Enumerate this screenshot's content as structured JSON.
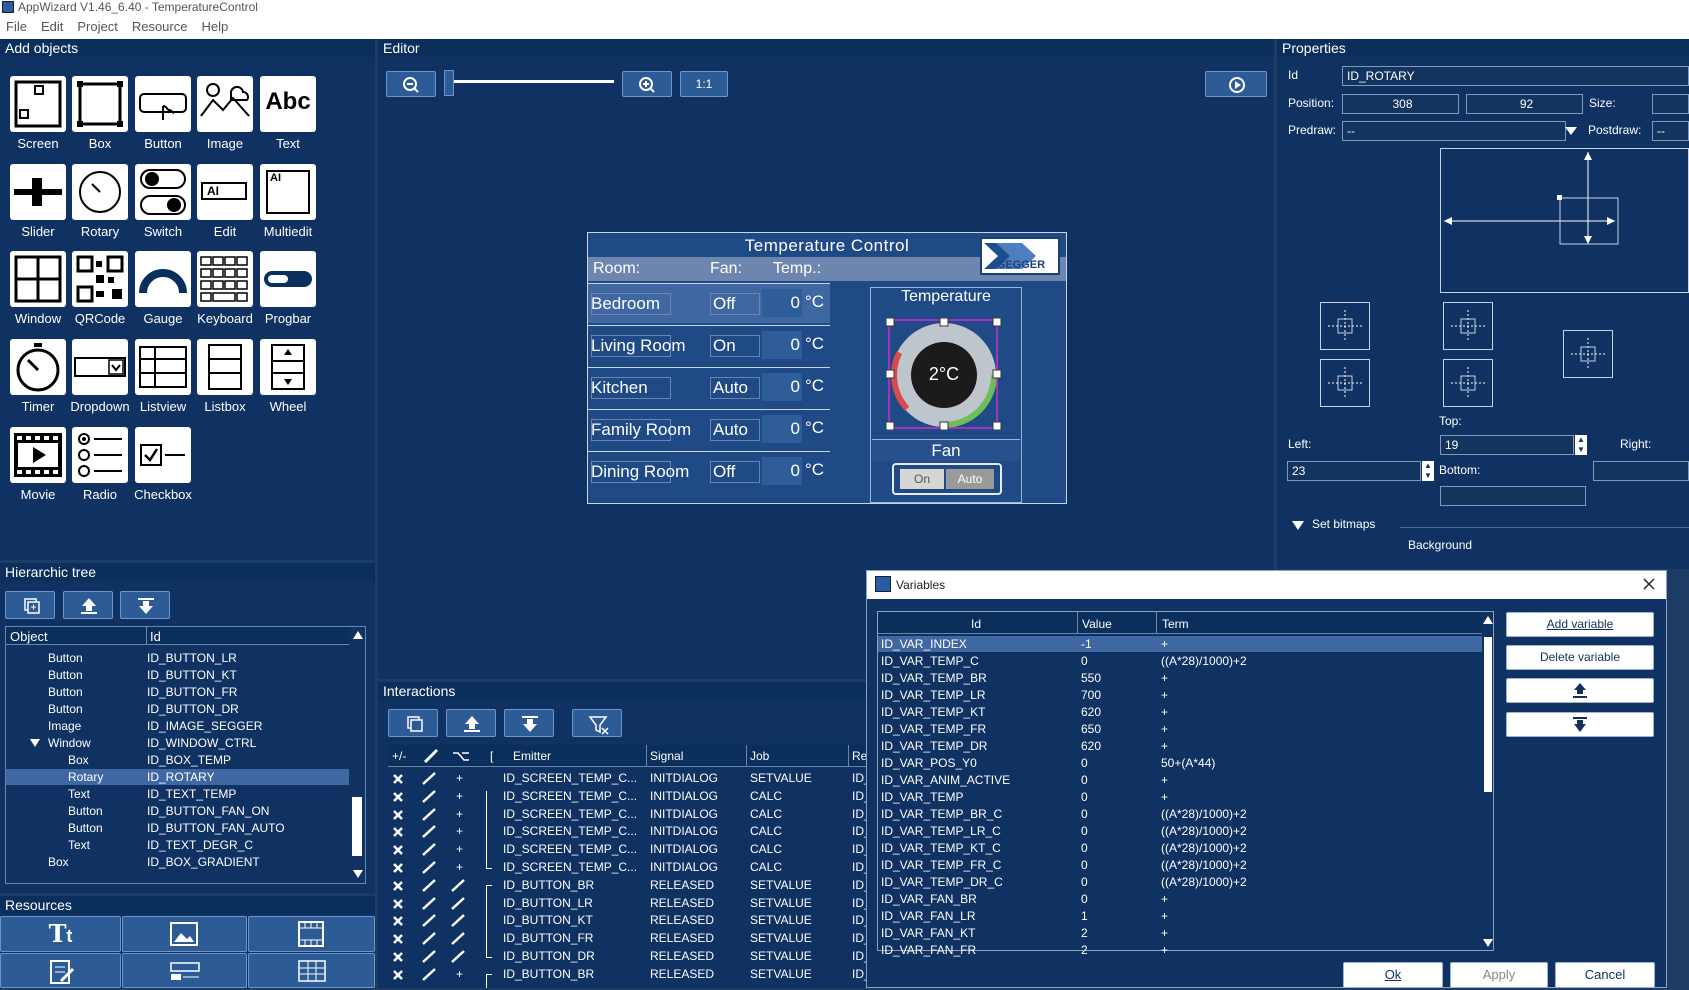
{
  "window": {
    "title": "AppWizard V1.46_6.40 - TemperatureControl"
  },
  "menu": [
    "File",
    "Edit",
    "Project",
    "Resource",
    "Help"
  ],
  "add_objects": {
    "title": "Add objects",
    "items": [
      {
        "label": "Screen",
        "icon": "screen-icon"
      },
      {
        "label": "Box",
        "icon": "box-icon"
      },
      {
        "label": "Button",
        "icon": "button-icon"
      },
      {
        "label": "Image",
        "icon": "image-icon"
      },
      {
        "label": "Text",
        "icon": "text-icon",
        "glyph": "Abc"
      },
      {
        "label": "Slider",
        "icon": "slider-icon"
      },
      {
        "label": "Rotary",
        "icon": "rotary-icon"
      },
      {
        "label": "Switch",
        "icon": "switch-icon"
      },
      {
        "label": "Edit",
        "icon": "edit-icon",
        "glyph": "AI"
      },
      {
        "label": "Multiedit",
        "icon": "multiedit-icon",
        "glyph": "AI"
      },
      {
        "label": "Window",
        "icon": "window-icon"
      },
      {
        "label": "QRCode",
        "icon": "qrcode-icon"
      },
      {
        "label": "Gauge",
        "icon": "gauge-icon"
      },
      {
        "label": "Keyboard",
        "icon": "keyboard-icon"
      },
      {
        "label": "Progbar",
        "icon": "progbar-icon"
      },
      {
        "label": "Timer",
        "icon": "timer-icon"
      },
      {
        "label": "Dropdown",
        "icon": "dropdown-icon"
      },
      {
        "label": "Listview",
        "icon": "listview-icon"
      },
      {
        "label": "Listbox",
        "icon": "listbox-icon"
      },
      {
        "label": "Wheel",
        "icon": "wheel-icon"
      },
      {
        "label": "Movie",
        "icon": "movie-icon"
      },
      {
        "label": "Radio",
        "icon": "radio-icon"
      },
      {
        "label": "Checkbox",
        "icon": "checkbox-icon"
      }
    ]
  },
  "editor": {
    "title": "Editor",
    "zoom_label": "1:1",
    "preview": {
      "title": "Temperature Control",
      "logo": "SEGGER",
      "header": {
        "room": "Room:",
        "fan": "Fan:",
        "temp": "Temp.:"
      },
      "rows": [
        {
          "room": "Bedroom",
          "fan": "Off",
          "temp": "0",
          "unit": "°C"
        },
        {
          "room": "Living Room",
          "fan": "On",
          "temp": "0",
          "unit": "°C"
        },
        {
          "room": "Kitchen",
          "fan": "Auto",
          "temp": "0",
          "unit": "°C"
        },
        {
          "room": "Family Room",
          "fan": "Auto",
          "temp": "0",
          "unit": "°C"
        },
        {
          "room": "Dining Room",
          "fan": "Off",
          "temp": "0",
          "unit": "°C"
        }
      ],
      "temperature_label": "Temperature",
      "dial_value": "2°C",
      "fan_label": "Fan",
      "fan_on": "On",
      "fan_auto": "Auto"
    }
  },
  "properties": {
    "title": "Properties",
    "id_label": "Id",
    "id_value": "ID_ROTARY",
    "position_label": "Position:",
    "pos_x": "308",
    "pos_y": "92",
    "size_label": "Size:",
    "predraw_label": "Predraw:",
    "predraw_value": "--",
    "postdraw_label": "Postdraw:",
    "postdraw_value": "--",
    "top_label": "Top:",
    "top_value": "19",
    "left_label": "Left:",
    "left_value": "23",
    "right_label": "Right:",
    "bottom_label": "Bottom:",
    "set_bitmaps": "Set bitmaps",
    "background_label": "Background"
  },
  "hierarchic_tree": {
    "title": "Hierarchic tree",
    "col_object": "Object",
    "col_id": "Id",
    "rows": [
      {
        "object": "Button",
        "id": "ID_BUTTON_LR"
      },
      {
        "object": "Button",
        "id": "ID_BUTTON_KT"
      },
      {
        "object": "Button",
        "id": "ID_BUTTON_FR"
      },
      {
        "object": "Button",
        "id": "ID_BUTTON_DR"
      },
      {
        "object": "Image",
        "id": "ID_IMAGE_SEGGER"
      },
      {
        "object": "Window",
        "id": "ID_WINDOW_CTRL"
      },
      {
        "object": "Box",
        "id": "ID_BOX_TEMP"
      },
      {
        "object": "Rotary",
        "id": "ID_ROTARY"
      },
      {
        "object": "Text",
        "id": "ID_TEXT_TEMP"
      },
      {
        "object": "Button",
        "id": "ID_BUTTON_FAN_ON"
      },
      {
        "object": "Button",
        "id": "ID_BUTTON_FAN_AUTO"
      },
      {
        "object": "Text",
        "id": "ID_TEXT_DEGR_C"
      },
      {
        "object": "Box",
        "id": "ID_BOX_GRADIENT"
      }
    ]
  },
  "resources": {
    "title": "Resources"
  },
  "interactions": {
    "title": "Interactions",
    "col_plusminus": "+/-",
    "col_bracket": "[",
    "col_emitter": "Emitter",
    "col_signal": "Signal",
    "col_job": "Job",
    "col_re": "Re",
    "rows": [
      {
        "cond": "+",
        "emitter": "ID_SCREEN_TEMP_C...",
        "signal": "INITDIALOG",
        "job": "SETVALUE",
        "re": "ID_"
      },
      {
        "cond": "+",
        "emitter": "ID_SCREEN_TEMP_C...",
        "signal": "INITDIALOG",
        "job": "CALC",
        "re": "ID_"
      },
      {
        "cond": "+",
        "emitter": "ID_SCREEN_TEMP_C...",
        "signal": "INITDIALOG",
        "job": "CALC",
        "re": "ID_"
      },
      {
        "cond": "+",
        "emitter": "ID_SCREEN_TEMP_C...",
        "signal": "INITDIALOG",
        "job": "CALC",
        "re": "ID_"
      },
      {
        "cond": "+",
        "emitter": "ID_SCREEN_TEMP_C...",
        "signal": "INITDIALOG",
        "job": "CALC",
        "re": "ID_"
      },
      {
        "cond": "+",
        "emitter": "ID_SCREEN_TEMP_C...",
        "signal": "INITDIALOG",
        "job": "CALC",
        "re": "ID_"
      },
      {
        "cond": "",
        "emitter": "ID_BUTTON_BR",
        "signal": "RELEASED",
        "job": "SETVALUE",
        "re": "ID_"
      },
      {
        "cond": "",
        "emitter": "ID_BUTTON_LR",
        "signal": "RELEASED",
        "job": "SETVALUE",
        "re": "ID_"
      },
      {
        "cond": "",
        "emitter": "ID_BUTTON_KT",
        "signal": "RELEASED",
        "job": "SETVALUE",
        "re": "ID_"
      },
      {
        "cond": "",
        "emitter": "ID_BUTTON_FR",
        "signal": "RELEASED",
        "job": "SETVALUE",
        "re": "ID_"
      },
      {
        "cond": "",
        "emitter": "ID_BUTTON_DR",
        "signal": "RELEASED",
        "job": "SETVALUE",
        "re": "ID_"
      },
      {
        "cond": "+",
        "emitter": "ID_BUTTON_BR",
        "signal": "RELEASED",
        "job": "SETVALUE",
        "re": "ID_"
      }
    ]
  },
  "variables": {
    "title": "Variables",
    "col_id": "Id",
    "col_value": "Value",
    "col_term": "Term",
    "add_button": "Add variable",
    "delete_button": "Delete variable",
    "ok_button": "Ok",
    "apply_button": "Apply",
    "cancel_button": "Cancel",
    "rows": [
      {
        "id": "ID_VAR_INDEX",
        "value": "-1",
        "term": "+"
      },
      {
        "id": "ID_VAR_TEMP_C",
        "value": "0",
        "term": "((A*28)/1000)+2"
      },
      {
        "id": "ID_VAR_TEMP_BR",
        "value": "550",
        "term": "+"
      },
      {
        "id": "ID_VAR_TEMP_LR",
        "value": "700",
        "term": "+"
      },
      {
        "id": "ID_VAR_TEMP_KT",
        "value": "620",
        "term": "+"
      },
      {
        "id": "ID_VAR_TEMP_FR",
        "value": "650",
        "term": "+"
      },
      {
        "id": "ID_VAR_TEMP_DR",
        "value": "620",
        "term": "+"
      },
      {
        "id": "ID_VAR_POS_Y0",
        "value": "0",
        "term": "50+(A*44)"
      },
      {
        "id": "ID_VAR_ANIM_ACTIVE",
        "value": "0",
        "term": "+"
      },
      {
        "id": "ID_VAR_TEMP",
        "value": "0",
        "term": "+"
      },
      {
        "id": "ID_VAR_TEMP_BR_C",
        "value": "0",
        "term": "((A*28)/1000)+2"
      },
      {
        "id": "ID_VAR_TEMP_LR_C",
        "value": "0",
        "term": "((A*28)/1000)+2"
      },
      {
        "id": "ID_VAR_TEMP_KT_C",
        "value": "0",
        "term": "((A*28)/1000)+2"
      },
      {
        "id": "ID_VAR_TEMP_FR_C",
        "value": "0",
        "term": "((A*28)/1000)+2"
      },
      {
        "id": "ID_VAR_TEMP_DR_C",
        "value": "0",
        "term": "((A*28)/1000)+2"
      },
      {
        "id": "ID_VAR_FAN_BR",
        "value": "0",
        "term": "+"
      },
      {
        "id": "ID_VAR_FAN_LR",
        "value": "1",
        "term": "+"
      },
      {
        "id": "ID_VAR_FAN_KT",
        "value": "2",
        "term": "+"
      },
      {
        "id": "ID_VAR_FAN_FR",
        "value": "2",
        "term": "+"
      }
    ]
  }
}
